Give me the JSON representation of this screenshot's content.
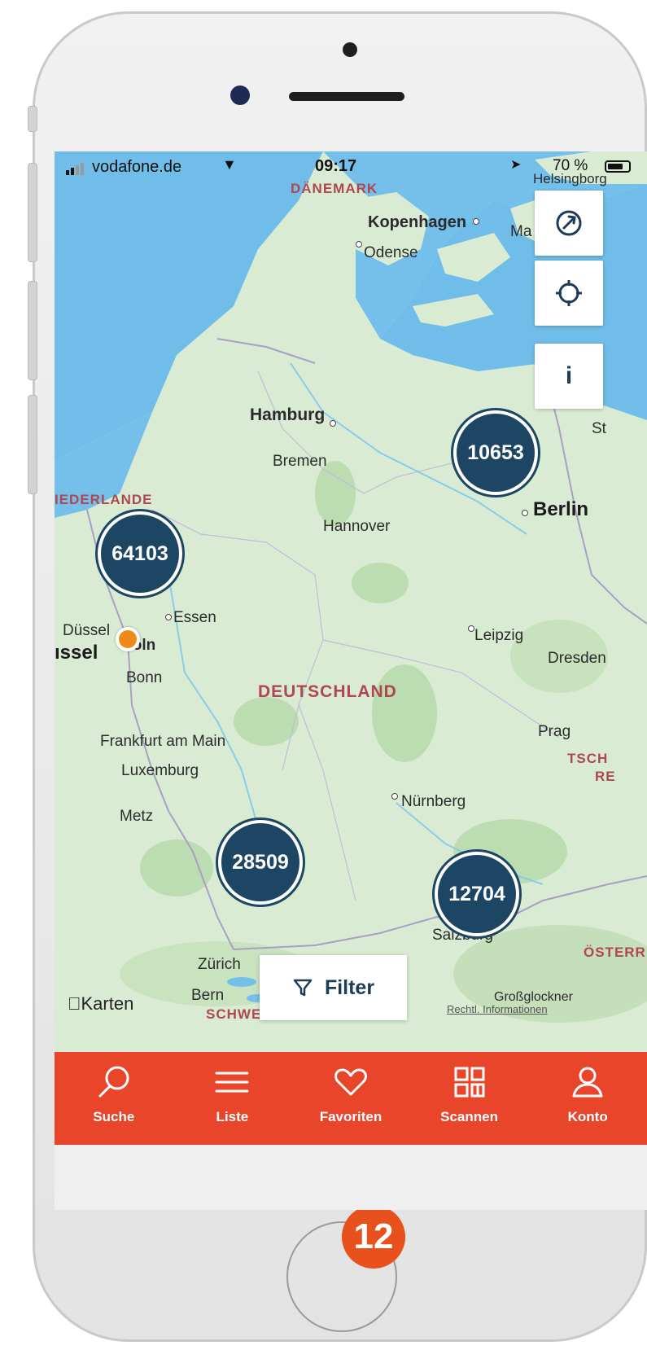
{
  "status_bar": {
    "carrier": "vodafone.de",
    "time": "09:17",
    "battery": "70 %"
  },
  "map": {
    "labels": {
      "daenemark": "DÄNEMARK",
      "kopenhagen": "Kopenhagen",
      "odense": "Odense",
      "helsingborg": "Helsingborg",
      "malmoe": "Ma",
      "hamburg": "Hamburg",
      "bremen": "Bremen",
      "stettin": "St",
      "niederlande": "IEDERLANDE",
      "hannover": "Hannover",
      "berlin": "Berlin",
      "duesseldorf": "Düssel",
      "essen": "Essen",
      "koeln": "Köln",
      "issel": "ıssel",
      "bonn": "Bonn",
      "leipzig": "Leipzig",
      "dresden": "Dresden",
      "deutschland": "DEUTSCHLAND",
      "frankfurt": "Frankfurt am Main",
      "luxemburg": "Luxemburg",
      "prag": "Prag",
      "tsch": "TSCH",
      "re": "RE",
      "nuernberg": "Nürnberg",
      "metz": "Metz",
      "salzburg": "Salzburg",
      "oesterreich": "ÖSTERR",
      "zuerich": "Zürich",
      "bern": "Bern",
      "schweiz": "SCHWEIZ",
      "grossglockner": "Großglockner"
    },
    "clusters": [
      {
        "id": "berlin",
        "count": "10653"
      },
      {
        "id": "nrw",
        "count": "64103"
      },
      {
        "id": "southwest",
        "count": "28509"
      },
      {
        "id": "bavaria",
        "count": "12704"
      }
    ],
    "controls": {
      "rotate_icon": "rotation-arrow-icon",
      "locate_icon": "crosshair-icon",
      "info_label": "i"
    },
    "filter_label": "Filter",
    "attribution": "Karten",
    "legal_link": "Rechtl. Informationen"
  },
  "tabs": [
    {
      "label": "Suche",
      "icon": "search-icon"
    },
    {
      "label": "Liste",
      "icon": "list-icon"
    },
    {
      "label": "Favoriten",
      "icon": "heart-icon"
    },
    {
      "label": "Scannen",
      "icon": "qr-code-icon"
    },
    {
      "label": "Konto",
      "icon": "user-icon"
    }
  ],
  "step_badge": "12",
  "colors": {
    "tabbar": "#e8452a",
    "cluster": "#1d4664",
    "user_pin": "#ef8a17",
    "badge": "#e8501c"
  }
}
